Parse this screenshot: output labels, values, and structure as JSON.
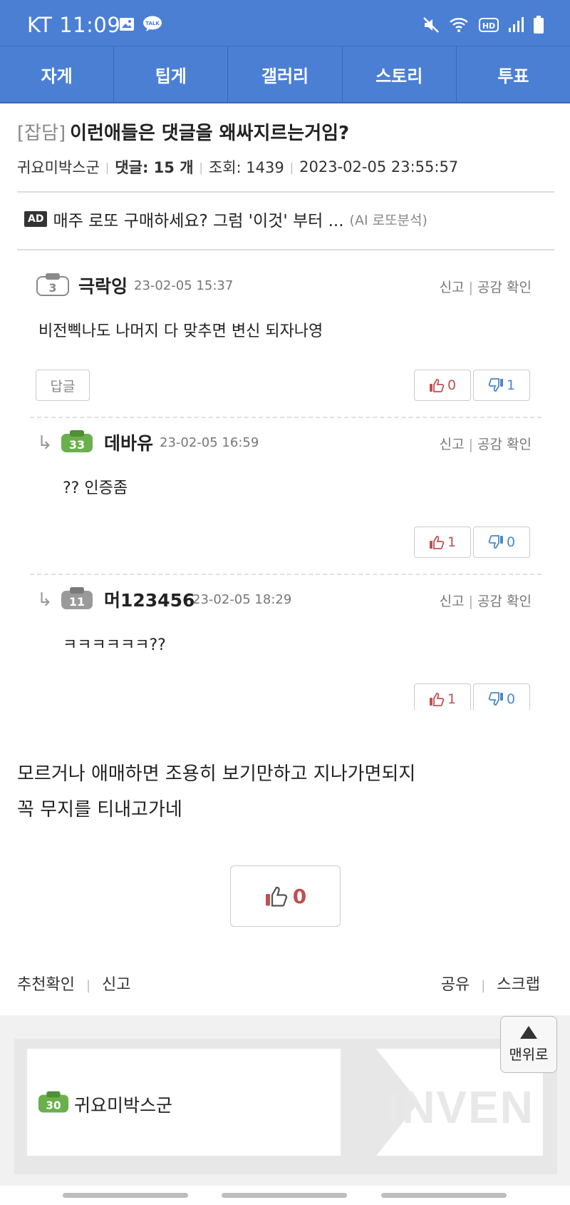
{
  "status_bar": {
    "carrier_time": "KT 11:09",
    "left_icons": [
      "image-icon",
      "talk-icon"
    ],
    "talk_label": "TALK",
    "right_icons": [
      "mute-icon",
      "wifi-icon",
      "hd-icon",
      "signal-icon",
      "battery-icon"
    ],
    "hd_label": "HD"
  },
  "nav": {
    "tabs": [
      "자게",
      "팁게",
      "갤러리",
      "스토리",
      "투표"
    ]
  },
  "post": {
    "category": "[잡담]",
    "title": "이런애들은 댓글을 왜싸지르는거임?",
    "author": "귀요미박스군",
    "comments_label": "댓글: 15 개",
    "views_label": "조회: 1439",
    "datetime": "2023-02-05 23:55:57"
  },
  "ad": {
    "badge": "AD",
    "text": "매주 로또 구매하세요? 그럼 '이것' 부터 ...",
    "sub": "(AI 로또분석)"
  },
  "comments": [
    {
      "level": "3",
      "author": "극락잉",
      "date": "23-02-05 15:37",
      "report": "신고",
      "like_check": "공감 확인",
      "text": "비전삑나도 나머지 다 맞추면 변신 되자나영",
      "reply_label": "답글",
      "up": "0",
      "down": "1"
    },
    {
      "level": "33",
      "author": "데바유",
      "date": "23-02-05 16:59",
      "report": "신고",
      "like_check": "공감 확인",
      "text": "?? 인증좀",
      "up": "1",
      "down": "0"
    },
    {
      "level": "11",
      "author": "머123456",
      "date": "23-02-05 18:29",
      "report": "신고",
      "like_check": "공감 확인",
      "text": "ㅋㅋㅋㅋㅋㅋ??",
      "up": "1",
      "down": "0"
    }
  ],
  "body": {
    "line1": "모르거나 애매하면 조용히 보기만하고 지나가면되지",
    "line2": "꼭 무지를 티내고가네"
  },
  "recommend": {
    "count": "0"
  },
  "links": {
    "rec_check": "추천확인",
    "report": "신고",
    "share": "공유",
    "scrap": "스크랩"
  },
  "profile": {
    "level": "30",
    "name": "귀요미박스군",
    "logo": "INVEN"
  },
  "to_top": {
    "label": "맨위로"
  },
  "colors": {
    "header_blue": "#4a7fd4",
    "level_green": "#6ab04c",
    "level_gray": "#8a8a8a",
    "up_red": "#c05050",
    "down_blue": "#4a88c8"
  }
}
